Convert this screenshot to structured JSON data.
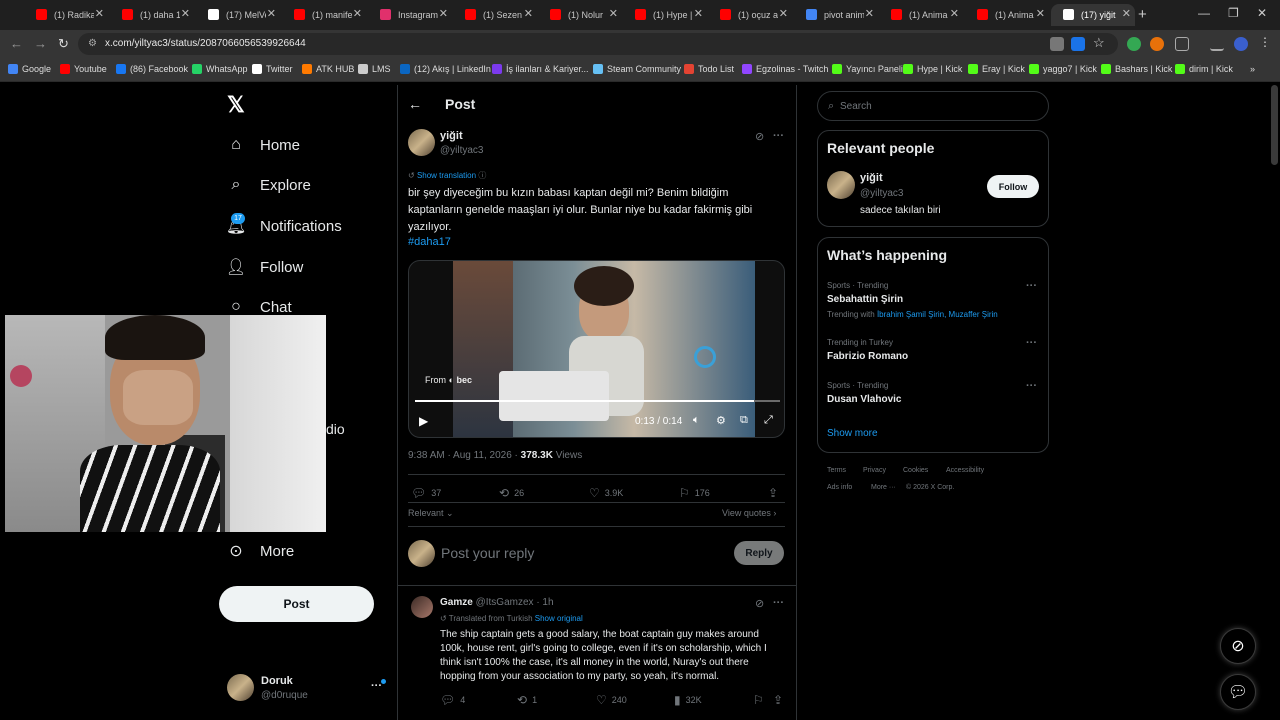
{
  "browser": {
    "tabs": [
      {
        "label": "(1) Radika",
        "color": "#ff0000"
      },
      {
        "label": "(1) daha 1",
        "color": "#ff0000"
      },
      {
        "label": "(17) MelVe",
        "color": "#ffffff"
      },
      {
        "label": "(1) manife",
        "color": "#ff0000"
      },
      {
        "label": "Instagram",
        "color": "#e1306c"
      },
      {
        "label": "(1) Sezen",
        "color": "#ff0000"
      },
      {
        "label": "(1) Nolur",
        "color": "#ff0000"
      },
      {
        "label": "(1) Hype |",
        "color": "#ff0000"
      },
      {
        "label": "(1) oçuz al",
        "color": "#ff0000"
      },
      {
        "label": "pivot anim",
        "color": "#4285f4"
      },
      {
        "label": "(1) Anima",
        "color": "#ff0000"
      },
      {
        "label": "(1) Anima",
        "color": "#ff0000"
      },
      {
        "label": "(17) yiğit",
        "color": "#ffffff"
      }
    ],
    "url": "x.com/yiltyac3/status/2087066056539926644",
    "bookmarks": [
      {
        "label": "Google",
        "color": "#4285f4"
      },
      {
        "label": "Youtube",
        "color": "#ff0000"
      },
      {
        "label": "(86) Facebook",
        "color": "#1877f2"
      },
      {
        "label": "WhatsApp",
        "color": "#25d366"
      },
      {
        "label": "Twitter",
        "color": "#ffffff"
      },
      {
        "label": "ATK HUB",
        "color": "#ff7a00"
      },
      {
        "label": "LMS",
        "color": "#cccccc"
      },
      {
        "label": "(12) Akış | LinkedIn",
        "color": "#0a66c2"
      },
      {
        "label": "İş ilanları & Kariyer...",
        "color": "#7c3aed"
      },
      {
        "label": "Steam Community",
        "color": "#66c0f4"
      },
      {
        "label": "Todo List",
        "color": "#e44332"
      },
      {
        "label": "Egzolinas - Twitch",
        "color": "#9146ff"
      },
      {
        "label": "Yayıncı Paneli",
        "color": "#53fc18"
      },
      {
        "label": "Hype | Kick",
        "color": "#53fc18"
      },
      {
        "label": "Eray | Kick",
        "color": "#53fc18"
      },
      {
        "label": "yaggo7 | Kick",
        "color": "#53fc18"
      },
      {
        "label": "Bashars | Kick",
        "color": "#53fc18"
      },
      {
        "label": "dirim | Kick",
        "color": "#53fc18"
      }
    ]
  },
  "sidebar": {
    "items": [
      {
        "label": "Home",
        "icon": "home-icon"
      },
      {
        "label": "Explore",
        "icon": "search-icon"
      },
      {
        "label": "Notifications",
        "icon": "bell-icon"
      },
      {
        "label": "Follow",
        "icon": "person-add-icon"
      },
      {
        "label": "Chat",
        "icon": "chat-icon"
      },
      {
        "label": "More",
        "icon": "more-circle-icon"
      }
    ],
    "partial_label": "dio",
    "notifications_badge": "17",
    "post_button": "Post",
    "profile_name": "Doruk",
    "profile_handle": "@d0ruque"
  },
  "post": {
    "header": "Post",
    "author_name": "yiğit",
    "author_handle": "@yiltyac3",
    "show_translation": "Show translation",
    "text": "bir şey diyeceğim bu kızın babası kaptan değil mi? Benim bildiğim kaptanların genelde maaşları iyi olur. Bunlar niye bu kadar fakirmiş gibi yazılıyor.",
    "hashtag": "#daha17",
    "video_source_prefix": "From",
    "video_source": "bec",
    "video_time": "0:13 / 0:14",
    "video_progress": 0.93,
    "timestamp": "9:38 AM · Aug 11, 2026 · ",
    "views": "378.3K",
    "views_label": " Views",
    "replies": "37",
    "reposts": "26",
    "likes": "3.9K",
    "bookmarks": "176",
    "sort": "Relevant",
    "view_quotes": "View quotes",
    "reply_placeholder": "Post your reply",
    "reply_button": "Reply"
  },
  "reply": {
    "author_name": "Gamze",
    "author_handle": "@ItsGamzex",
    "time": "· 1h",
    "translated": "Translated from Turkish",
    "show_original": "Show original",
    "text": "The ship captain gets a good salary, the boat captain guy makes around 100k, house rent, girl's going to college, even if it's on scholarship, which I think isn't 100% the case, it's all money in the world, Nuray's out there hopping from your association to my party, so yeah, it's normal.",
    "replies": "4",
    "reposts": "1",
    "likes": "240",
    "views": "32K"
  },
  "right": {
    "search_placeholder": "Search",
    "relevant_title": "Relevant people",
    "person_name": "yiğit",
    "person_handle": "@yiltyac3",
    "person_bio": "sadece takılan biri",
    "follow_button": "Follow",
    "happening_title": "What’s happening",
    "trends": [
      {
        "category": "Sports · Trending",
        "name": "Sebahattin Şirin",
        "with_prefix": "Trending with ",
        "with": "İbrahim Şamil Şirin, Muzaffer Şirin"
      },
      {
        "category": "Trending in Turkey",
        "name": "Fabrizio Romano"
      },
      {
        "category": "Sports · Trending",
        "name": "Dusan Vlahovic"
      }
    ],
    "show_more": "Show more",
    "footer": [
      "Terms",
      "Privacy",
      "Cookies",
      "Accessibility",
      "Ads info",
      "More ···",
      "© 2026 X Corp."
    ]
  },
  "colors": {
    "accent": "#1d9bf0",
    "bg": "#000000",
    "border": "#2f3336",
    "muted": "#71767b"
  }
}
